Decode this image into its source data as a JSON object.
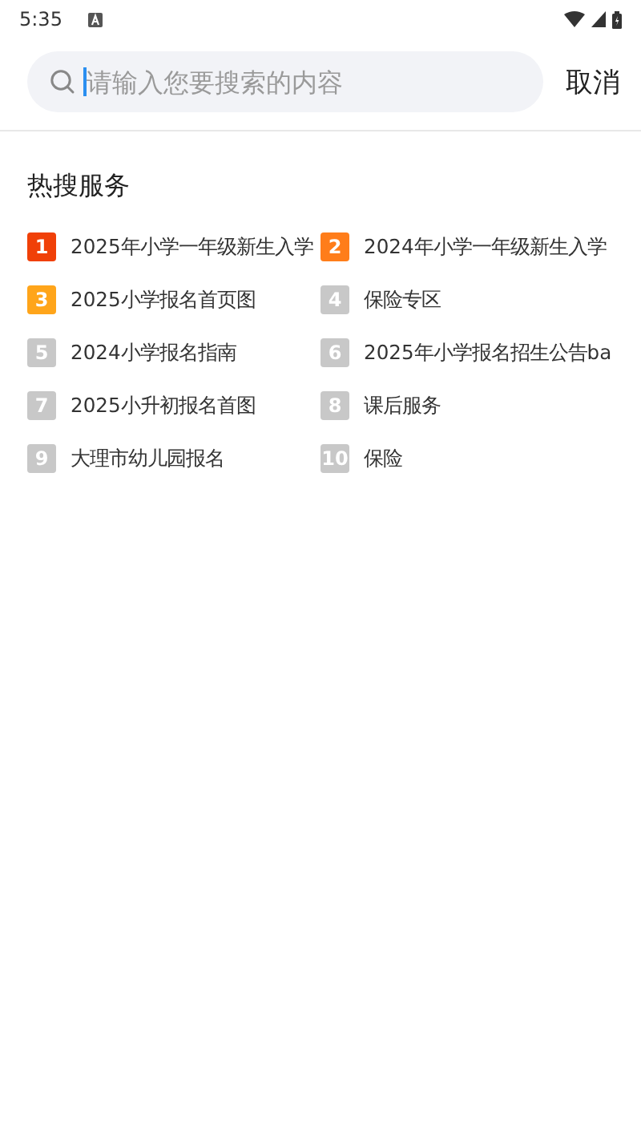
{
  "status_bar": {
    "time": "5:35"
  },
  "search": {
    "placeholder": "请输入您要搜索的内容",
    "cancel": "取消"
  },
  "hot": {
    "title": "热搜服务",
    "items": [
      {
        "rank": "1",
        "text": "2025年小学一年级新生入学",
        "color": "#f04008"
      },
      {
        "rank": "2",
        "text": "2024年小学一年级新生入学",
        "color": "#ff7d1a"
      },
      {
        "rank": "3",
        "text": "2025小学报名首页图",
        "color": "#ffa51a"
      },
      {
        "rank": "4",
        "text": "保险专区",
        "color": "#c8c8c8"
      },
      {
        "rank": "5",
        "text": "2024小学报名指南",
        "color": "#c8c8c8"
      },
      {
        "rank": "6",
        "text": "2025年小学报名招生公告ba",
        "color": "#c8c8c8"
      },
      {
        "rank": "7",
        "text": "2025小升初报名首图",
        "color": "#c8c8c8"
      },
      {
        "rank": "8",
        "text": "课后服务",
        "color": "#c8c8c8"
      },
      {
        "rank": "9",
        "text": "大理市幼儿园报名",
        "color": "#c8c8c8"
      },
      {
        "rank": "10",
        "text": "保险",
        "color": "#c8c8c8"
      }
    ]
  }
}
